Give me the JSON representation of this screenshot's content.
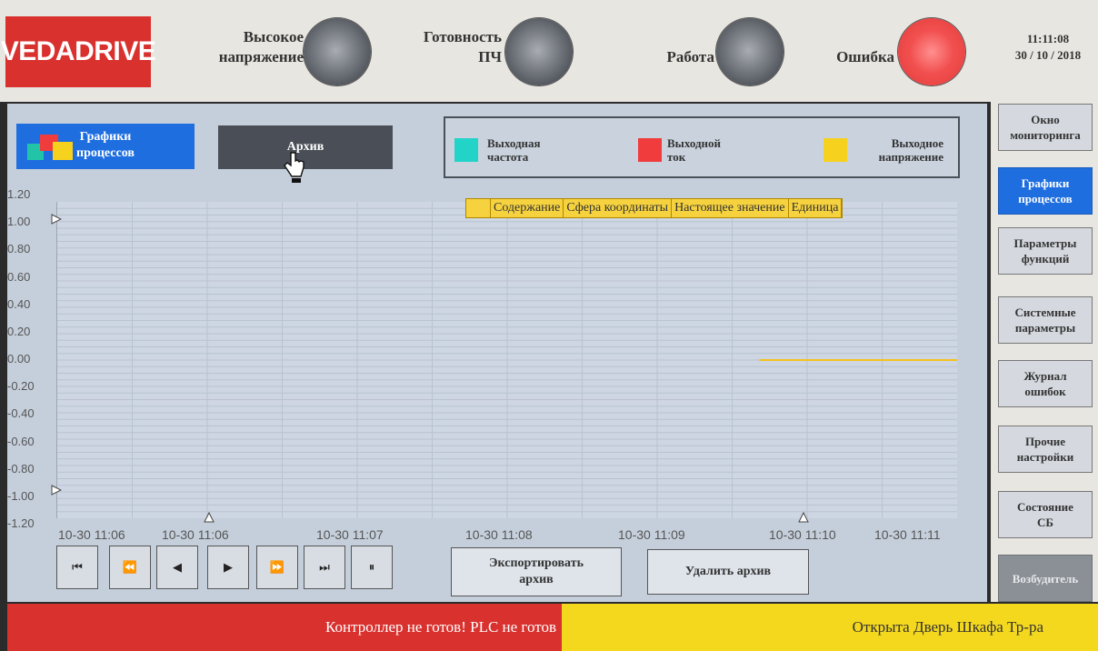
{
  "header": {
    "logo": "VEDADRIVE",
    "indicators": [
      {
        "line1": "Высокое",
        "line2": "напряжение",
        "state": "off"
      },
      {
        "line1": "Готовность",
        "line2": "ПЧ",
        "state": "off"
      },
      {
        "line1": "Работа",
        "line2": "",
        "state": "off"
      },
      {
        "line1": "Ошибка",
        "line2": "",
        "state": "on"
      }
    ],
    "time": "11:11:08",
    "date": "30 / 10 / 2018"
  },
  "tabs": {
    "graphs_line1": "Графики",
    "graphs_line2": "процессов",
    "archive": "Архив"
  },
  "legend": [
    {
      "line1": "Выходная",
      "line2": "частота",
      "color": "#22d3c8"
    },
    {
      "line1": "Выходной",
      "line2": "ток",
      "color": "#f03c3c"
    },
    {
      "line1": "Выходное",
      "line2": "напряжение",
      "color": "#f6d21e"
    }
  ],
  "table_header": [
    "",
    "Содержание",
    "Сфера координаты",
    "Настоящее значение",
    "Единица"
  ],
  "chart_data": {
    "type": "line",
    "y_ticks": [
      "1.20",
      "1.00",
      "0.80",
      "0.60",
      "0.40",
      "0.20",
      "0.00",
      "-0.20",
      "-0.40",
      "-0.60",
      "-0.80",
      "-1.00",
      "-1.20"
    ],
    "x_ticks": [
      "10-30 11:06",
      "10-30 11:06",
      "10-30 11:07",
      "10-30 11:08",
      "10-30 11:09",
      "10-30 11:10",
      "10-30 11:11"
    ],
    "ylim": [
      -1.2,
      1.2
    ],
    "grid": true,
    "series": [
      {
        "name": "Выходное напряжение",
        "color": "#f6c21e",
        "x_start_fraction": 0.78,
        "value": 0.0
      }
    ]
  },
  "nav_buttons": [
    "⏮",
    "⏪",
    "◀",
    "▶",
    "⏩",
    "⏭",
    "⏸"
  ],
  "actions": {
    "export_line1": "Экспортировать",
    "export_line2": "архив",
    "delete": "Удалить архив"
  },
  "sidebar": [
    {
      "line1": "Окно",
      "line2": "мониторинга",
      "state": "normal"
    },
    {
      "line1": "Графики",
      "line2": "процессов",
      "state": "active"
    },
    {
      "line1": "Параметры",
      "line2": "функций",
      "state": "normal"
    },
    {
      "line1": "Системные",
      "line2": "параметры",
      "state": "normal"
    },
    {
      "line1": "Журнал",
      "line2": "ошибок",
      "state": "normal"
    },
    {
      "line1": "Прочие",
      "line2": "настройки",
      "state": "normal"
    },
    {
      "line1": "Состояние",
      "line2": "СБ",
      "state": "normal"
    },
    {
      "line1": "Возбудитель",
      "line2": "",
      "state": "disabled"
    }
  ],
  "status": {
    "left": "Контроллер не готов!  PLC не готов",
    "right": "Открыта Дверь Шкафа Тр-ра"
  }
}
